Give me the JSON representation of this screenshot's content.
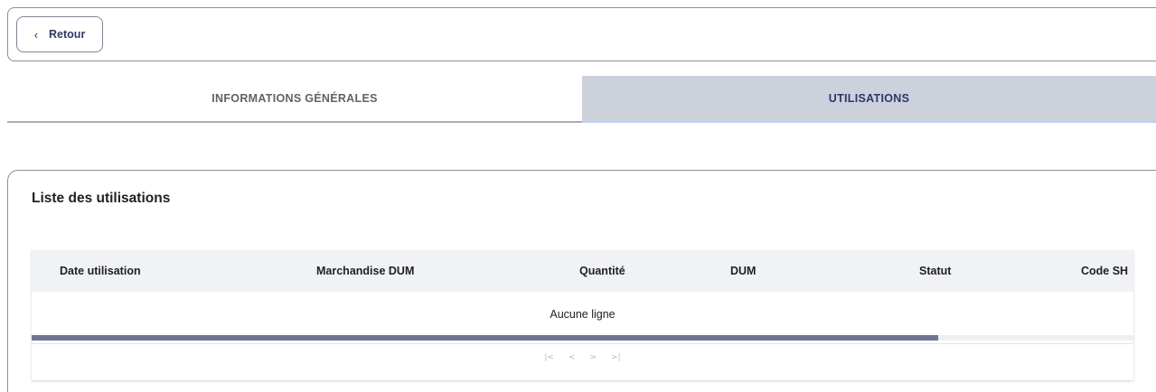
{
  "header": {
    "back_label": "Retour",
    "back_icon": "chevron-left-icon"
  },
  "tabs": [
    {
      "label": "INFORMATIONS GÉNÉRALES",
      "active": false
    },
    {
      "label": "UTILISATIONS",
      "active": true
    }
  ],
  "colors": {
    "accent": "#2c3768",
    "active_tab_bg": "#cdd1dc",
    "scroll_thumb": "#6d7593"
  },
  "card": {
    "title": "Liste des utilisations",
    "columns": [
      "Date utilisation",
      "Marchandise DUM",
      "Quantité",
      "DUM",
      "Statut",
      "Code SH"
    ],
    "empty_message": "Aucune ligne",
    "horizontal_scroll_fraction": 0.823,
    "pager": {
      "first": "|<",
      "prev": "<",
      "next": ">",
      "last": ">|"
    }
  }
}
